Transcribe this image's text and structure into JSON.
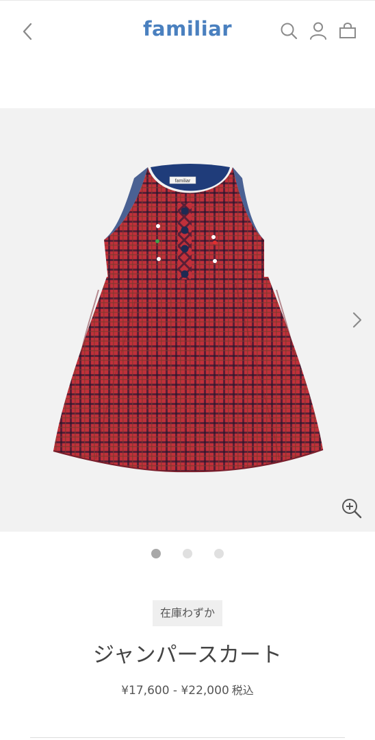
{
  "header": {
    "logo_text": "familiar",
    "icons": [
      "back-chevron-icon",
      "search-icon",
      "account-icon",
      "cart-bag-icon"
    ],
    "brand_color": "#4a80bf",
    "icon_color": "#8a8a8a"
  },
  "gallery": {
    "image_alt": "red plaid sleeveless jumper skirt",
    "label_text": "familiar",
    "slide_count": 3,
    "active_slide": 1,
    "background": "#f2f2f2"
  },
  "product": {
    "stock_badge": "在庫わずか",
    "name": "ジャンパースカート",
    "price": "¥17,600 - ¥22,000",
    "tax_label": "税込"
  }
}
